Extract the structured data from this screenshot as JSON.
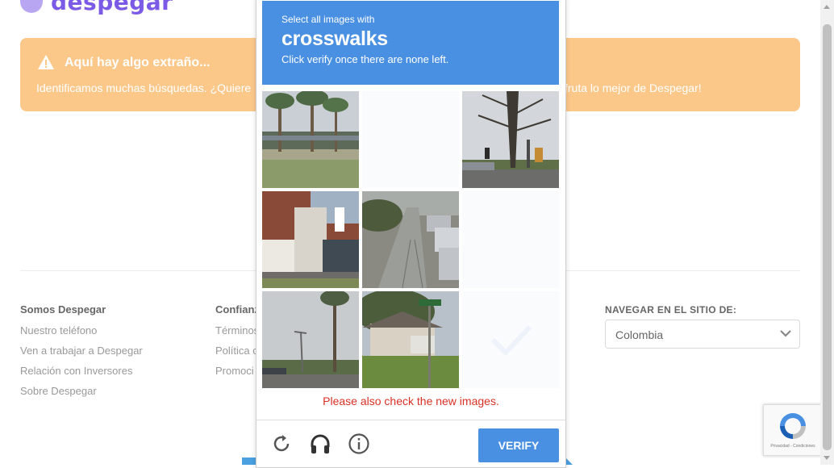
{
  "brand": {
    "name": "despegar"
  },
  "alert": {
    "title": "Aquí hay algo extraño...",
    "text_left": "Identificamos muchas búsquedas. ¿Quiere",
    "text_right": "fruta lo mejor de Despegar!"
  },
  "footer": {
    "col1": {
      "heading": "Somos Despegar",
      "links": [
        "Nuestro teléfono",
        "Ven a trabajar a Despegar",
        "Relación con Inversores",
        "Sobre Despegar"
      ]
    },
    "col2": {
      "heading": "Confianz",
      "links": [
        "Términos",
        "Política c",
        "Promoci"
      ]
    },
    "nav": {
      "heading": "NAVEGAR EN EL SITIO DE:",
      "selected": "Colombia"
    }
  },
  "captcha": {
    "instruction_pre": "Select all images with",
    "keyword": "crosswalks",
    "instruction_sub": "Click verify once there are none left.",
    "message": "Please also check the new images.",
    "verify_label": "VERIFY",
    "tiles": [
      {
        "scene": "palm-trees-parking"
      },
      {
        "scene": "blank-loading"
      },
      {
        "scene": "intersection-traffic-light"
      },
      {
        "scene": "brick-house-truck"
      },
      {
        "scene": "street-parked-cars"
      },
      {
        "scene": "blank-loading"
      },
      {
        "scene": "palm-streetlight"
      },
      {
        "scene": "house-street-sign"
      },
      {
        "scene": "blank-loading"
      }
    ]
  },
  "recaptcha_badge": {
    "text": "Privacidad - Condiciones"
  },
  "colors": {
    "captcha_blue": "#4a90e2",
    "alert_bg": "#fcc88a",
    "brand_purple": "#7b5ae6",
    "error_red": "#d93025"
  }
}
